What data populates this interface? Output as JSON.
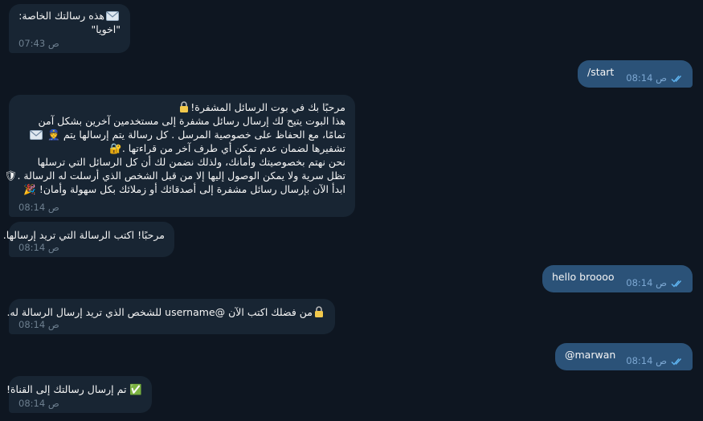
{
  "messages": [
    {
      "id": "m1",
      "side": "in",
      "lines": [
        "هذه رسالتك الخاصة:",
        "\"اخويا\""
      ],
      "time": "07:43",
      "ampm": "ص"
    },
    {
      "id": "m2",
      "side": "out",
      "text": "/start",
      "time": "08:14",
      "ampm": "ص"
    },
    {
      "id": "m3",
      "side": "in",
      "lines": [
        "مرحبًا بك في بوت الرسائل المشفرة!",
        "هذا البوت يتيح لك إرسال رسائل مشفرة إلى مستخدمين آخرين بشكل آمن",
        "تمامًا، مع الحفاظ على خصوصية المرسل . كل رسالة يتم إرسالها يتم",
        "تشفيرها لضمان عدم تمكن أي طرف آخر من قراءتها .",
        "نحن نهتم بخصوصيتك وأمانك، ولذلك نضمن لك أن كل الرسائل التي ترسلها",
        "تظل سرية ولا يمكن الوصول إليها إلا من قبل الشخص الذي أرسلت له الرسالة .",
        "ابدأ الآن بإرسال رسائل مشفرة إلى أصدقائك أو زملائك بكل سهولة وأمان!"
      ],
      "time": "08:14",
      "ampm": "ص"
    },
    {
      "id": "m4",
      "side": "in",
      "lines": [
        "مرحبًا! اكتب الرسالة التي تريد إرسالها."
      ],
      "time": "08:14",
      "ampm": "ص"
    },
    {
      "id": "m5",
      "side": "out",
      "text": "hello broooo",
      "time": "08:14",
      "ampm": "ص"
    },
    {
      "id": "m6",
      "side": "in",
      "lines": [
        "من فضلك اكتب الآن @username للشخص الذي تريد إرسال الرسالة له."
      ],
      "time": "08:14",
      "ampm": "ص"
    },
    {
      "id": "m7",
      "side": "out",
      "text": "@marwan",
      "time": "08:14",
      "ampm": "ص"
    },
    {
      "id": "m8",
      "side": "in",
      "lines": [
        "تم إرسال رسالتك إلى القناة!"
      ],
      "time": "08:14",
      "ampm": "ص"
    }
  ],
  "emojis": {
    "lock": "lock-icon",
    "envelope": "envelope-icon",
    "shield": "shield-icon",
    "locked_key": "locked-key-icon",
    "police": "police-officer-icon",
    "party": "party-popper-icon",
    "check_box": "check-mark-button-icon",
    "party_char": "🎉",
    "police_char": "👮",
    "check_char": "✅",
    "shield_char": "🛡",
    "key_char": "🔐"
  },
  "colors": {
    "background": "#0e1621",
    "incoming_bubble": "#182533",
    "outgoing_bubble": "#2b5278",
    "text": "#f5f5f5",
    "incoming_meta": "#6d7f8f",
    "outgoing_meta": "#7da8d3",
    "read_check": "#5fb4f0"
  }
}
